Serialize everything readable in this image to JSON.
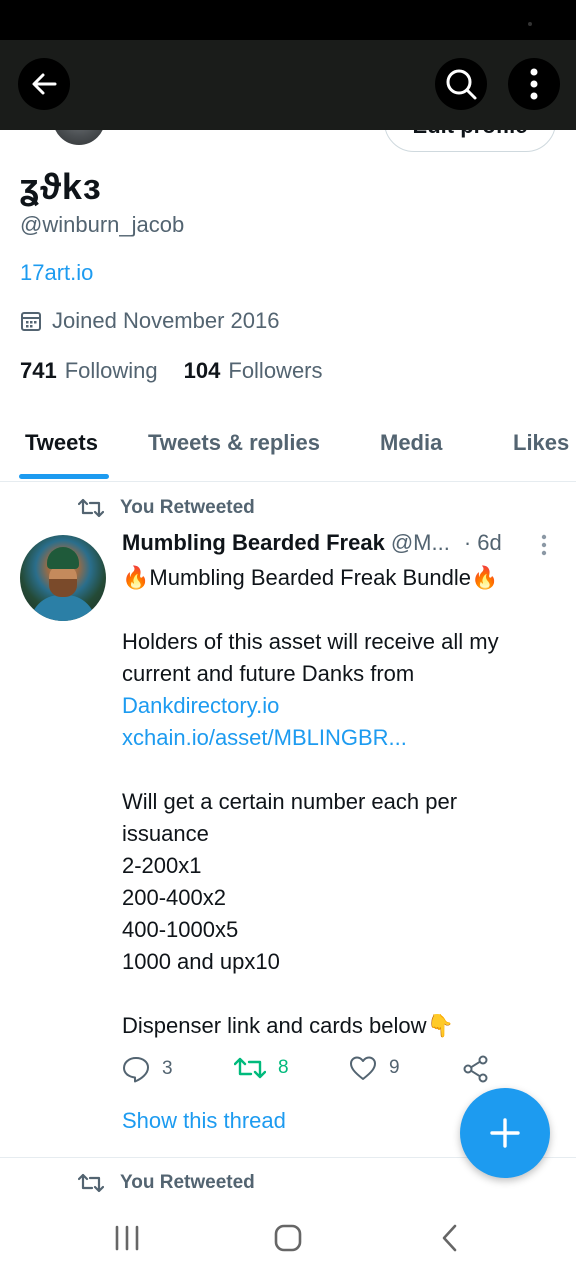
{
  "profile": {
    "display_name": "ʓϑkɜ",
    "handle": "@winburn_jacob",
    "website": "17art.io",
    "joined": "Joined November 2016",
    "following_count": "741",
    "following_label": "Following",
    "followers_count": "104",
    "followers_label": "Followers",
    "edit_profile_label": "Edit profile"
  },
  "tabs": [
    {
      "label": "Tweets",
      "active": true
    },
    {
      "label": "Tweets & replies",
      "active": false
    },
    {
      "label": "Media",
      "active": false
    },
    {
      "label": "Likes",
      "active": false
    }
  ],
  "tweet": {
    "retweet_label": "You Retweeted",
    "author_name": "Mumbling Bearded Freak",
    "author_handle": "@M...",
    "time": "· 6d",
    "lines": {
      "l1": "🔥Mumbling Bearded Freak Bundle🔥",
      "l2": "Holders of this asset will receive all my",
      "l3": "current and future Danks from",
      "l4": "Dankdirectory.io",
      "l5": "xchain.io/asset/MBLINGBR...",
      "l6": "Will get a certain number each per",
      "l7": "issuance",
      "l8": "2-200x1",
      "l9": "200-400x2",
      "l10": "400-1000x5",
      "l11": "1000 and upx10",
      "l12": "Dispenser link and cards below👇"
    },
    "reply_count": "3",
    "retweet_count": "8",
    "like_count": "9",
    "show_thread": "Show this thread"
  },
  "next_tweet": {
    "retweet_label": "You Retweeted"
  },
  "colors": {
    "accent": "#1d9bf0",
    "retweet_green": "#00ba7c",
    "secondary_text": "#536471"
  },
  "icons": {
    "back": "arrow-left-icon",
    "search": "search-icon",
    "more": "more-vertical-icon",
    "calendar": "calendar-icon",
    "retweet": "retweet-icon",
    "reply": "reply-icon",
    "like": "heart-icon",
    "share": "share-icon",
    "compose": "plus-icon"
  }
}
